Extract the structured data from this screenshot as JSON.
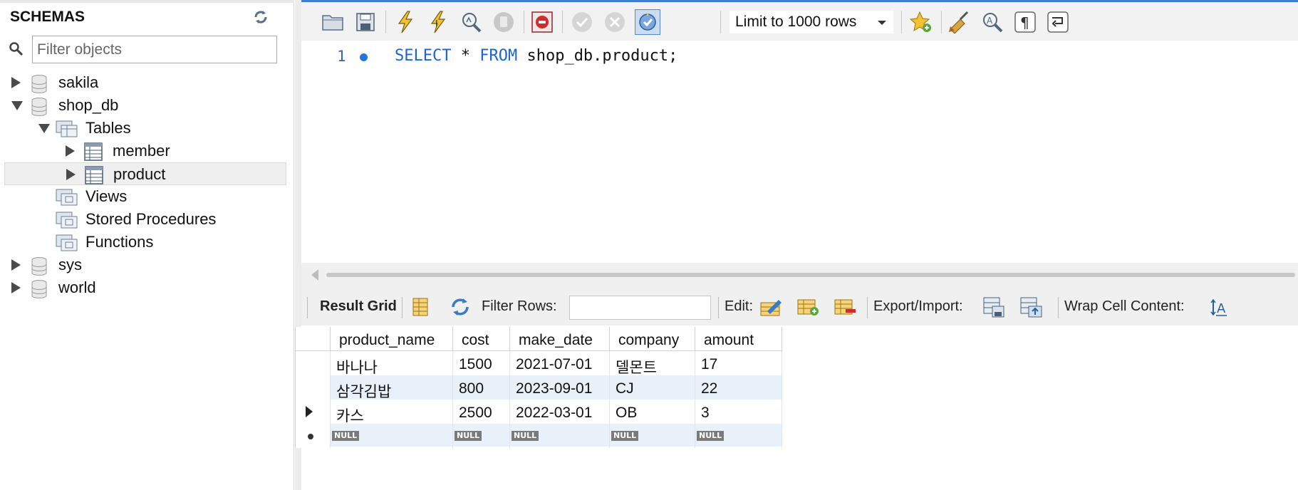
{
  "sidebar": {
    "title": "SCHEMAS",
    "filter_placeholder": "Filter objects",
    "tree": [
      {
        "label": "sakila",
        "kind": "schema",
        "expanded": false
      },
      {
        "label": "shop_db",
        "kind": "schema",
        "expanded": true
      },
      {
        "label": "Tables",
        "kind": "folder",
        "expanded": true
      },
      {
        "label": "member",
        "kind": "table",
        "expanded": false
      },
      {
        "label": "product",
        "kind": "table",
        "expanded": false,
        "selected": true
      },
      {
        "label": "Views",
        "kind": "folder"
      },
      {
        "label": "Stored Procedures",
        "kind": "folder"
      },
      {
        "label": "Functions",
        "kind": "folder"
      },
      {
        "label": "sys",
        "kind": "schema",
        "expanded": false
      },
      {
        "label": "world",
        "kind": "schema",
        "expanded": false
      }
    ]
  },
  "toolbar": {
    "icons": [
      "open-folder-icon",
      "save-icon",
      "execute-icon",
      "execute-current-icon",
      "explain-icon",
      "stop-icon",
      "error-stop-icon",
      "commit-icon",
      "rollback-icon",
      "autocommit-icon"
    ],
    "limit_label": "Limit to 1000 rows",
    "right_icons": [
      "bookmark-star-icon",
      "beautify-icon",
      "find-icon",
      "invisible-chars-icon",
      "wrap-icon"
    ]
  },
  "editor": {
    "line_number": "1",
    "sql_keyword_1": "SELECT",
    "sql_middle": " * ",
    "sql_keyword_2": "FROM",
    "sql_rest": " shop_db.product;"
  },
  "result_toolbar": {
    "result_grid": "Result Grid",
    "filter_rows": "Filter Rows:",
    "edit": "Edit:",
    "export_import": "Export/Import:",
    "wrap_cell": "Wrap Cell Content:"
  },
  "grid": {
    "columns": [
      "product_name",
      "cost",
      "make_date",
      "company",
      "amount"
    ],
    "rows": [
      [
        "바나나",
        "1500",
        "2021-07-01",
        "델몬트",
        "17"
      ],
      [
        "삼각김밥",
        "800",
        "2023-09-01",
        "CJ",
        "22"
      ],
      [
        "카스",
        "2500",
        "2022-03-01",
        "OB",
        "3"
      ]
    ],
    "null_label": "NULL",
    "colors": {
      "alt_row": "#e8f0fa",
      "header_border": "#d0d0d0"
    }
  }
}
